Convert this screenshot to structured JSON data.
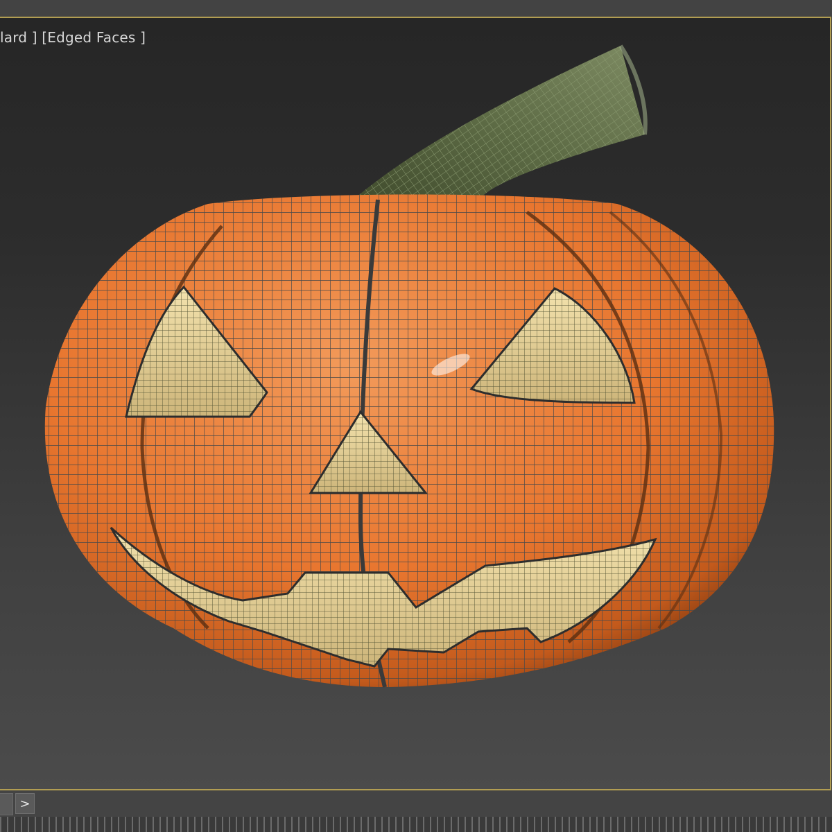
{
  "viewport": {
    "label": "lard ] [Edged Faces ]",
    "border_color": "#b19d52",
    "shading_mode": "Edged Faces"
  },
  "model": {
    "subject": "jack-o-lantern",
    "body_color": "#e8762f",
    "inner_color": "#eed9a0",
    "stem_color": "#56633f",
    "wire_color": "#4a4a4a"
  },
  "timeline": {
    "next_label": ">"
  }
}
